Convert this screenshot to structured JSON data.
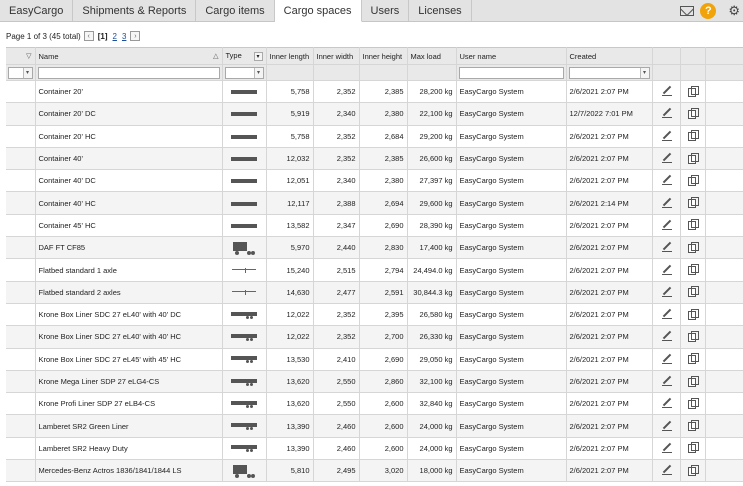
{
  "tabs": [
    {
      "label": "EasyCargo",
      "active": false
    },
    {
      "label": "Shipments & Reports",
      "active": false
    },
    {
      "label": "Cargo items",
      "active": false
    },
    {
      "label": "Cargo spaces",
      "active": true
    },
    {
      "label": "Users",
      "active": false
    },
    {
      "label": "Licenses",
      "active": false
    }
  ],
  "header_icons": {
    "mail": "mail-icon",
    "help": "?",
    "settings": "gear-icon"
  },
  "pager": {
    "summary": "Page 1 of 3 (45 total)",
    "prev": "‹",
    "current": "[1]",
    "pages": [
      "2",
      "3"
    ],
    "next": "›"
  },
  "columns": [
    "Name",
    "Type",
    "Inner length",
    "Inner width",
    "Inner height",
    "Max load",
    "User name",
    "Created"
  ],
  "rows": [
    {
      "name": "Container 20'",
      "type": "bar",
      "length": "5,758",
      "width": "2,352",
      "height": "2,385",
      "max_load": "28,200 kg",
      "user": "EasyCargo System",
      "created": "2/6/2021 2:07 PM"
    },
    {
      "name": "Container 20' DC",
      "type": "bar",
      "length": "5,919",
      "width": "2,340",
      "height": "2,380",
      "max_load": "22,100 kg",
      "user": "EasyCargo System",
      "created": "12/7/2022 7:01 PM"
    },
    {
      "name": "Container 20' HC",
      "type": "bar",
      "length": "5,758",
      "width": "2,352",
      "height": "2,684",
      "max_load": "29,200 kg",
      "user": "EasyCargo System",
      "created": "2/6/2021 2:07 PM"
    },
    {
      "name": "Container 40'",
      "type": "bar",
      "length": "12,032",
      "width": "2,352",
      "height": "2,385",
      "max_load": "26,600 kg",
      "user": "EasyCargo System",
      "created": "2/6/2021 2:07 PM"
    },
    {
      "name": "Container 40' DC",
      "type": "bar",
      "length": "12,051",
      "width": "2,340",
      "height": "2,380",
      "max_load": "27,397 kg",
      "user": "EasyCargo System",
      "created": "2/6/2021 2:07 PM"
    },
    {
      "name": "Container 40' HC",
      "type": "bar",
      "length": "12,117",
      "width": "2,388",
      "height": "2,694",
      "max_load": "29,600 kg",
      "user": "EasyCargo System",
      "created": "2/6/2021 2:14 PM"
    },
    {
      "name": "Container 45' HC",
      "type": "bar",
      "length": "13,582",
      "width": "2,347",
      "height": "2,690",
      "max_load": "28,390 kg",
      "user": "EasyCargo System",
      "created": "2/6/2021 2:07 PM"
    },
    {
      "name": "DAF FT CF85",
      "type": "truck",
      "length": "5,970",
      "width": "2,440",
      "height": "2,830",
      "max_load": "17,400 kg",
      "user": "EasyCargo System",
      "created": "2/6/2021 2:07 PM"
    },
    {
      "name": "Flatbed standard 1 axle",
      "type": "flat",
      "length": "15,240",
      "width": "2,515",
      "height": "2,794",
      "max_load": "24,494.0 kg",
      "user": "EasyCargo System",
      "created": "2/6/2021 2:07 PM"
    },
    {
      "name": "Flatbed standard 2 axles",
      "type": "flat",
      "length": "14,630",
      "width": "2,477",
      "height": "2,591",
      "max_load": "30,844.3 kg",
      "user": "EasyCargo System",
      "created": "2/6/2021 2:07 PM"
    },
    {
      "name": "Krone Box Liner SDC 27 eL40' with 40' DC",
      "type": "trailer",
      "length": "12,022",
      "width": "2,352",
      "height": "2,395",
      "max_load": "26,580 kg",
      "user": "EasyCargo System",
      "created": "2/6/2021 2:07 PM"
    },
    {
      "name": "Krone Box Liner SDC 27 eL40' with 40' HC",
      "type": "trailer",
      "length": "12,022",
      "width": "2,352",
      "height": "2,700",
      "max_load": "26,330 kg",
      "user": "EasyCargo System",
      "created": "2/6/2021 2:07 PM"
    },
    {
      "name": "Krone Box Liner SDC 27 eL45' with 45' HC",
      "type": "trailer",
      "length": "13,530",
      "width": "2,410",
      "height": "2,690",
      "max_load": "29,050 kg",
      "user": "EasyCargo System",
      "created": "2/6/2021 2:07 PM"
    },
    {
      "name": "Krone Mega Liner SDP 27 eLG4-CS",
      "type": "trailer",
      "length": "13,620",
      "width": "2,550",
      "height": "2,860",
      "max_load": "32,100 kg",
      "user": "EasyCargo System",
      "created": "2/6/2021 2:07 PM"
    },
    {
      "name": "Krone Profi Liner SDP 27 eLB4-CS",
      "type": "trailer",
      "length": "13,620",
      "width": "2,550",
      "height": "2,600",
      "max_load": "32,840 kg",
      "user": "EasyCargo System",
      "created": "2/6/2021 2:07 PM"
    },
    {
      "name": "Lamberet SR2 Green Liner",
      "type": "trailer",
      "length": "13,390",
      "width": "2,460",
      "height": "2,600",
      "max_load": "24,000 kg",
      "user": "EasyCargo System",
      "created": "2/6/2021 2:07 PM"
    },
    {
      "name": "Lamberet SR2 Heavy Duty",
      "type": "trailer",
      "length": "13,390",
      "width": "2,460",
      "height": "2,600",
      "max_load": "24,000 kg",
      "user": "EasyCargo System",
      "created": "2/6/2021 2:07 PM"
    },
    {
      "name": "Mercedes-Benz Actros 1836/1841/1844 LS",
      "type": "truck",
      "length": "5,810",
      "width": "2,495",
      "height": "3,020",
      "max_load": "18,000 kg",
      "user": "EasyCargo System",
      "created": "2/6/2021 2:07 PM"
    }
  ]
}
